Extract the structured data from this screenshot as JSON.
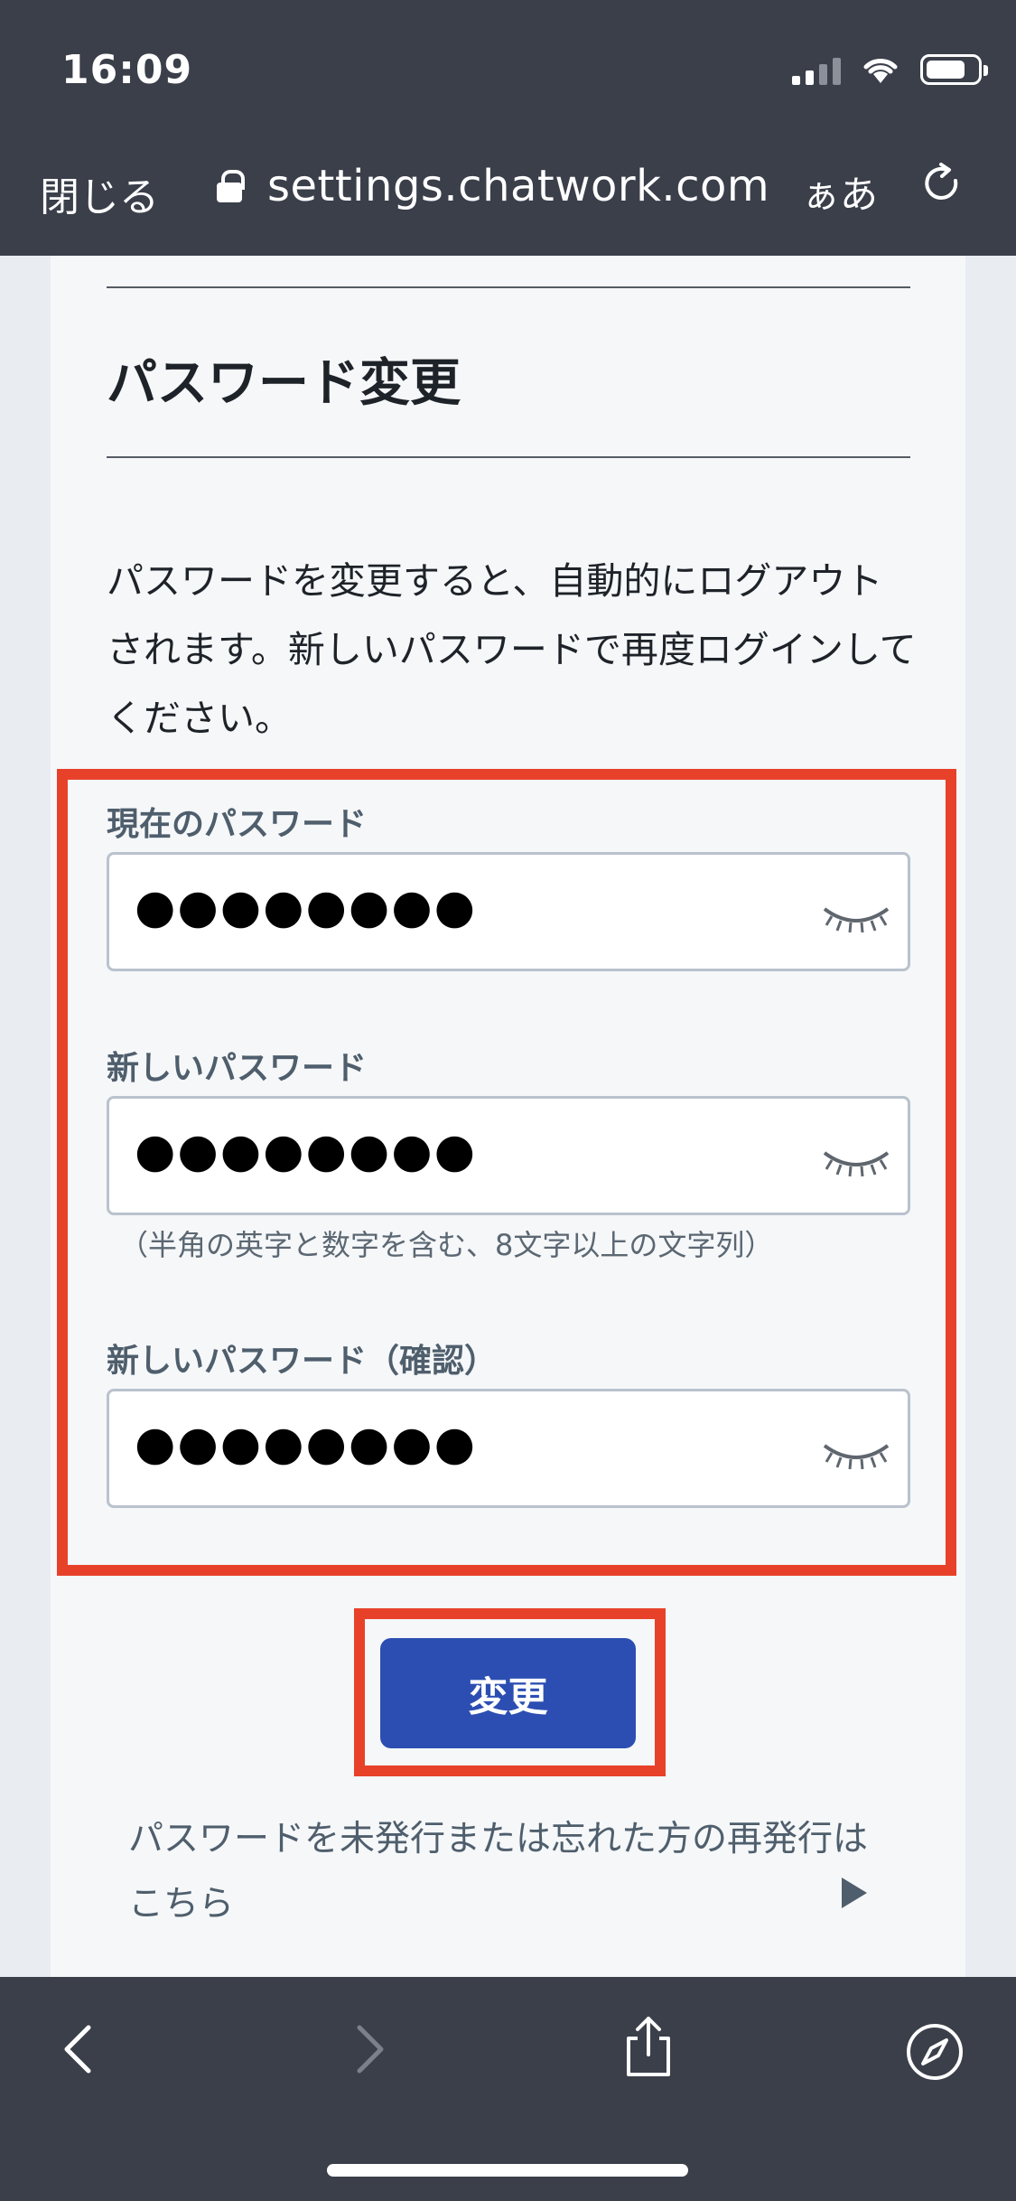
{
  "status_bar": {
    "time": "16:09"
  },
  "browser": {
    "close_label": "閉じる",
    "url": "settings.chatwork.com",
    "text_size_label": "ぁあ"
  },
  "page": {
    "title": "パスワード変更",
    "description": "パスワードを変更すると、自動的にログアウトされます。新しいパスワードで再度ログインしてください。",
    "fields": [
      {
        "label": "現在のパスワード",
        "value": "●●●●●●●●"
      },
      {
        "label": "新しいパスワード",
        "value": "●●●●●●●●",
        "hint": "（半角の英字と数字を含む、8文字以上の文字列）"
      },
      {
        "label": "新しいパスワード（確認）",
        "value": "●●●●●●●●"
      }
    ],
    "submit_label": "変更",
    "reset_link": "パスワードを未発行または忘れた方の再発行はこちら"
  },
  "colors": {
    "primary_button": "#2c4eb2",
    "highlight": "#e8412a",
    "toolbar": "#3a3f4a"
  }
}
